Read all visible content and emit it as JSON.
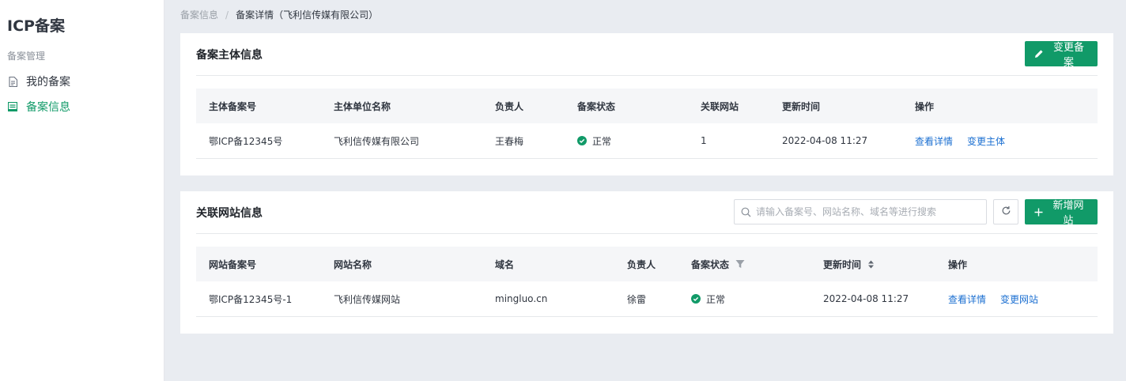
{
  "app": {
    "title": "ICP备案"
  },
  "sidebar": {
    "group_title": "备案管理",
    "items": [
      {
        "label": "我的备案",
        "icon": "document-icon"
      },
      {
        "label": "备案信息",
        "icon": "list-icon"
      }
    ]
  },
  "breadcrumb": {
    "items": [
      "备案信息",
      "备案详情（飞利信传媒有限公司）"
    ],
    "separator": "/"
  },
  "subject_card": {
    "title": "备案主体信息",
    "change_button": "变更备案",
    "columns": [
      "主体备案号",
      "主体单位名称",
      "负责人",
      "备案状态",
      "关联网站",
      "更新时间",
      "操作"
    ],
    "rows": [
      {
        "record_no": "鄂ICP备12345号",
        "company": "飞利信传媒有限公司",
        "owner": "王春梅",
        "status": "正常",
        "sites": "1",
        "updated": "2022-04-08 11:27",
        "actions": [
          "查看详情",
          "变更主体"
        ]
      }
    ]
  },
  "site_card": {
    "title": "关联网站信息",
    "search_placeholder": "请输入备案号、网站名称、域名等进行搜索",
    "add_button": "新增网站",
    "columns": [
      "网站备案号",
      "网站名称",
      "域名",
      "负责人",
      "备案状态",
      "更新时间",
      "操作"
    ],
    "rows": [
      {
        "record_no": "鄂ICP备12345号-1",
        "site_name": "飞利信传媒网站",
        "domain": "mingluo.cn",
        "owner": "徐雷",
        "status": "正常",
        "updated": "2022-04-08 11:27",
        "actions": [
          "查看详情",
          "变更网站"
        ]
      }
    ]
  },
  "colors": {
    "primary": "#119a68",
    "link": "#1b6fd1",
    "status_ok": "#119a68"
  }
}
